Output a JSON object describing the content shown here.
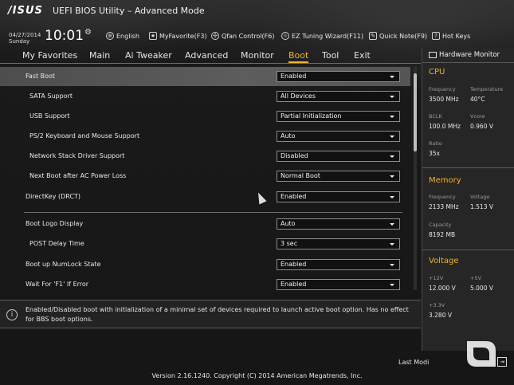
{
  "brand": "/ISUS",
  "title": "UEFI BIOS Utility – Advanced Mode",
  "date": "04/27/2014",
  "day": "Sunday",
  "time": "10:01",
  "toolbar": [
    {
      "icon": "globe-icon",
      "label": "English"
    },
    {
      "icon": "favorite-icon",
      "label": "MyFavorite(F3)"
    },
    {
      "icon": "fan-icon",
      "label": "Qfan Control(F6)"
    },
    {
      "icon": "bulb-icon",
      "label": "EZ Tuning Wizard(F11)"
    },
    {
      "icon": "note-icon",
      "label": "Quick Note(F9)"
    },
    {
      "icon": "help-key-icon",
      "label": "Hot Keys"
    }
  ],
  "nav": [
    "My Favorites",
    "Main",
    "Ai Tweaker",
    "Advanced",
    "Monitor",
    "Boot",
    "Tool",
    "Exit"
  ],
  "nav_active": "Boot",
  "settings": [
    {
      "label": "Fast Boot",
      "value": "Enabled",
      "indent": false,
      "selected": true
    },
    {
      "label": "SATA Support",
      "value": "All Devices",
      "indent": true
    },
    {
      "label": "USB Support",
      "value": "Partial Initialization",
      "indent": true
    },
    {
      "label": "PS/2 Keyboard and Mouse Support",
      "value": "Auto",
      "indent": true
    },
    {
      "label": "Network Stack Driver Support",
      "value": "Disabled",
      "indent": true
    },
    {
      "label": "Next Boot after AC Power Loss",
      "value": "Normal Boot",
      "indent": true
    },
    {
      "label": "DirectKey (DRCT)",
      "value": "Enabled",
      "indent": false
    },
    {
      "label": "Boot Logo Display",
      "value": "Auto",
      "indent": false
    },
    {
      "label": "POST Delay Time",
      "value": "3 sec",
      "indent": true
    },
    {
      "label": "Boot up NumLock State",
      "value": "Enabled",
      "indent": false
    },
    {
      "label": "Wait For 'F1' If Error",
      "value": "Enabled",
      "indent": false
    }
  ],
  "help_text": "Enabled/Disabled boot with initialization of a minimal set of devices required to launch active boot option. Has no effect for BBS boot options.",
  "hardware_monitor": {
    "title": "Hardware Monitor",
    "cpu": {
      "heading": "CPU",
      "frequency_label": "Frequency",
      "frequency": "3500 MHz",
      "temperature_label": "Temperature",
      "temperature": "40°C",
      "bclk_label": "BCLK",
      "bclk": "100.0 MHz",
      "vcore_label": "Vcore",
      "vcore": "0.960 V",
      "ratio_label": "Ratio",
      "ratio": "35x"
    },
    "memory": {
      "heading": "Memory",
      "frequency_label": "Frequency",
      "frequency": "2133 MHz",
      "voltage_label": "Voltage",
      "voltage": "1.513 V",
      "capacity_label": "Capacity",
      "capacity": "8192 MB"
    },
    "voltage": {
      "heading": "Voltage",
      "v12_label": "+12V",
      "v12": "12.000 V",
      "v5_label": "+5V",
      "v5": "5.000 V",
      "v33_label": "+3.3V",
      "v33": "3.280 V"
    }
  },
  "last_modified": "Last Modi",
  "version": "Version 2.16.1240. Copyright (C) 2014 American Megatrends, Inc.",
  "colors": {
    "accent": "#f0b429",
    "selected_row": "#555555",
    "background": "#1b1b1b"
  }
}
